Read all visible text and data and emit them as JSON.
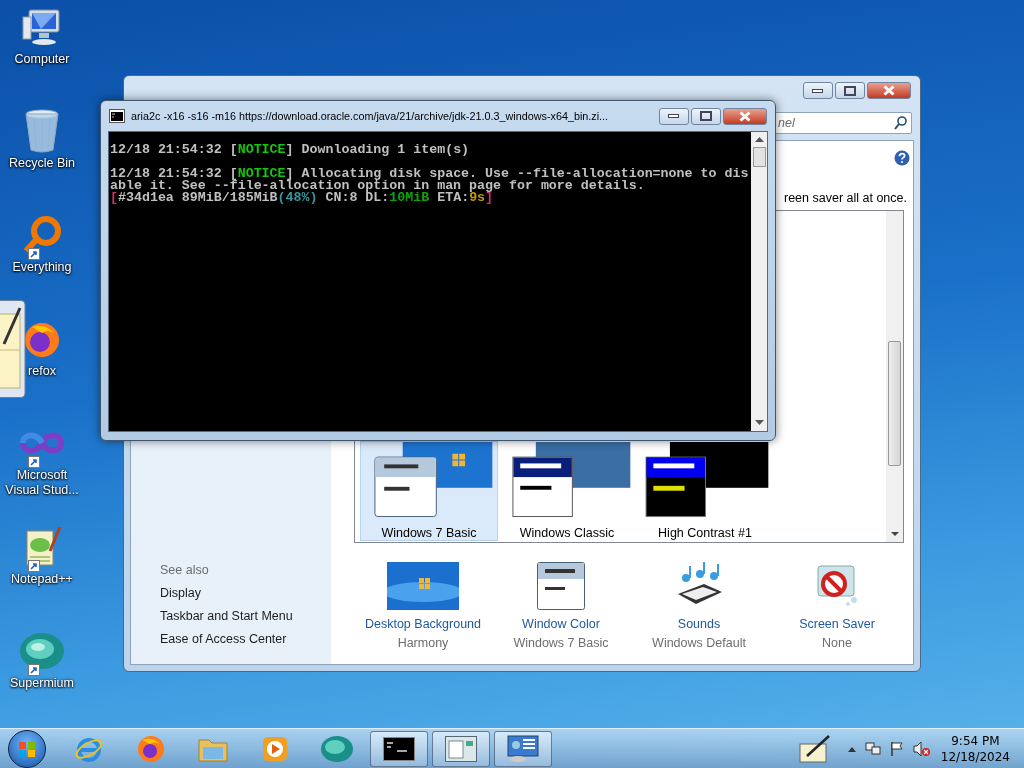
{
  "desktop_icons": [
    {
      "label": "Computer",
      "kind": "computer",
      "shortcut": false
    },
    {
      "label": "Recycle Bin",
      "kind": "recycle",
      "shortcut": false
    },
    {
      "label": "Everything",
      "kind": "ring",
      "shortcut": true
    },
    {
      "label": "refox",
      "kind": "flame",
      "shortcut": false
    },
    {
      "label": "Microsoft Visual Stud...",
      "kind": "infinity",
      "shortcut": true
    },
    {
      "label": "Notepad++",
      "kind": "notepad",
      "shortcut": true
    },
    {
      "label": "Supermium",
      "kind": "sphere",
      "shortcut": true
    }
  ],
  "control_panel": {
    "search": {
      "placeholder": "nel"
    },
    "description": "reen saver all at once.",
    "themes": [
      {
        "label": "Windows 7 Basic",
        "kind": "aero",
        "selected": true
      },
      {
        "label": "Windows Classic",
        "kind": "classic",
        "selected": false
      },
      {
        "label": "High Contrast #1",
        "kind": "contrast",
        "selected": false
      }
    ],
    "see_also": {
      "heading": "See also",
      "links": [
        "Display",
        "Taskbar and Start Menu",
        "Ease of Access Center"
      ]
    },
    "settings": [
      {
        "kind": "background",
        "label": "Desktop Background",
        "value": "Harmony"
      },
      {
        "kind": "color",
        "label": "Window Color",
        "value": "Windows 7 Basic"
      },
      {
        "kind": "sounds",
        "label": "Sounds",
        "value": "Windows Default"
      },
      {
        "kind": "saver",
        "label": "Screen Saver",
        "value": "None"
      }
    ]
  },
  "console": {
    "title": "aria2c  -x16 -s16 -m16 https://download.oracle.com/java/21/archive/jdk-21.0.3_windows-x64_bin.zi...",
    "messages": [
      {
        "lines": [
          [
            {
              "text": "12/18 21:54:32 [",
              "color": "#c0c0c0"
            },
            {
              "text": "NOTICE",
              "color": "#16c60c"
            },
            {
              "text": "] Downloading 1 item(s)",
              "color": "#c0c0c0"
            }
          ]
        ]
      },
      {
        "lines": [
          [
            {
              "text": "12/18 21:54:32 [",
              "color": "#c0c0c0"
            },
            {
              "text": "NOTICE",
              "color": "#16c60c"
            },
            {
              "text": "] Allocating disk space. Use --file-allocation=none to dis",
              "color": "#c0c0c0"
            }
          ],
          [
            {
              "text": "able it. See --file-allocation option in man page for more details.",
              "color": "#c0c0c0"
            }
          ],
          [
            {
              "text": "[",
              "color": "#d0306a"
            },
            {
              "text": "#34d1ea 89MiB/185MiB",
              "color": "#c0c0c0"
            },
            {
              "text": "(48%)",
              "color": "#3a96a0"
            },
            {
              "text": " CN:8 DL:",
              "color": "#c0c0c0"
            },
            {
              "text": "10MiB",
              "color": "#13a10e"
            },
            {
              "text": " ETA:",
              "color": "#c0c0c0"
            },
            {
              "text": "9s",
              "color": "#c19c00"
            },
            {
              "text": "]",
              "color": "#d0306a"
            }
          ]
        ]
      }
    ]
  },
  "taskbar": {
    "apps": [
      {
        "kind": "ie",
        "running": false
      },
      {
        "kind": "firefox",
        "running": false
      },
      {
        "kind": "explorer",
        "running": false
      },
      {
        "kind": "media",
        "running": false
      },
      {
        "kind": "supermium",
        "running": false
      },
      {
        "kind": "cmd",
        "running": true
      },
      {
        "kind": "window",
        "running": true
      },
      {
        "kind": "panel",
        "running": true
      }
    ],
    "clock": {
      "time": "9:54 PM",
      "date": "12/18/2024"
    }
  }
}
